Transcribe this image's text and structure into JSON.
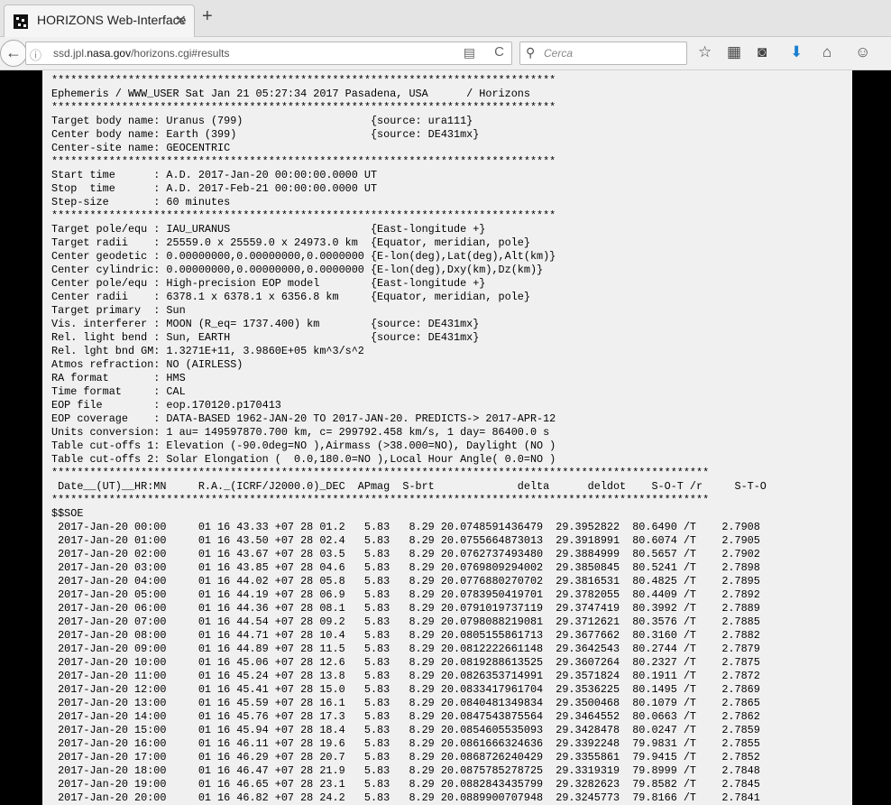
{
  "tab": {
    "title": "HORIZONS Web-Interface",
    "close": "✕",
    "new": "+"
  },
  "nav": {
    "back": "←",
    "url_prefix": "ssd.jpl.",
    "url_domain": "nasa.gov",
    "url_suffix": "/horizons.cgi#results",
    "reader": "▤",
    "reload": "C",
    "search_placeholder": "Cerca",
    "toolbar": [
      "☆",
      "▦",
      "◙",
      "⬇",
      "⌂",
      "☺"
    ]
  },
  "lines": [
    "*******************************************************************************",
    "Ephemeris / WWW_USER Sat Jan 21 05:27:34 2017 Pasadena, USA      / Horizons",
    "*******************************************************************************",
    "Target body name: Uranus (799)                    {source: ura111}",
    "Center body name: Earth (399)                     {source: DE431mx}",
    "Center-site name: GEOCENTRIC",
    "*******************************************************************************",
    "Start time      : A.D. 2017-Jan-20 00:00:00.0000 UT",
    "Stop  time      : A.D. 2017-Feb-21 00:00:00.0000 UT",
    "Step-size       : 60 minutes",
    "*******************************************************************************",
    "Target pole/equ : IAU_URANUS                      {East-longitude +}",
    "Target radii    : 25559.0 x 25559.0 x 24973.0 km  {Equator, meridian, pole}",
    "Center geodetic : 0.00000000,0.00000000,0.0000000 {E-lon(deg),Lat(deg),Alt(km)}",
    "Center cylindric: 0.00000000,0.00000000,0.0000000 {E-lon(deg),Dxy(km),Dz(km)}",
    "Center pole/equ : High-precision EOP model        {East-longitude +}",
    "Center radii    : 6378.1 x 6378.1 x 6356.8 km     {Equator, meridian, pole}",
    "Target primary  : Sun",
    "Vis. interferer : MOON (R_eq= 1737.400) km        {source: DE431mx}",
    "Rel. light bend : Sun, EARTH                      {source: DE431mx}",
    "Rel. lght bnd GM: 1.3271E+11, 3.9860E+05 km^3/s^2",
    "Atmos refraction: NO (AIRLESS)",
    "RA format       : HMS",
    "Time format     : CAL",
    "EOP file        : eop.170120.p170413",
    "EOP coverage    : DATA-BASED 1962-JAN-20 TO 2017-JAN-20. PREDICTS-> 2017-APR-12",
    "Units conversion: 1 au= 149597870.700 km, c= 299792.458 km/s, 1 day= 86400.0 s",
    "Table cut-offs 1: Elevation (-90.0deg=NO ),Airmass (>38.000=NO), Daylight (NO )",
    "Table cut-offs 2: Solar Elongation (  0.0,180.0=NO ),Local Hour Angle( 0.0=NO )",
    "*******************************************************************************************************",
    " Date__(UT)__HR:MN     R.A._(ICRF/J2000.0)_DEC  APmag  S-brt             delta      deldot    S-O-T /r     S-T-O",
    "*******************************************************************************************************",
    "$$SOE",
    " 2017-Jan-20 00:00     01 16 43.33 +07 28 01.2   5.83   8.29 20.0748591436479  29.3952822  80.6490 /T    2.7908",
    " 2017-Jan-20 01:00     01 16 43.50 +07 28 02.4   5.83   8.29 20.0755664873013  29.3918991  80.6074 /T    2.7905",
    " 2017-Jan-20 02:00     01 16 43.67 +07 28 03.5   5.83   8.29 20.0762737493480  29.3884999  80.5657 /T    2.7902",
    " 2017-Jan-20 03:00     01 16 43.85 +07 28 04.6   5.83   8.29 20.0769809294002  29.3850845  80.5241 /T    2.7898",
    " 2017-Jan-20 04:00     01 16 44.02 +07 28 05.8   5.83   8.29 20.0776880270702  29.3816531  80.4825 /T    2.7895",
    " 2017-Jan-20 05:00     01 16 44.19 +07 28 06.9   5.83   8.29 20.0783950419701  29.3782055  80.4409 /T    2.7892",
    " 2017-Jan-20 06:00     01 16 44.36 +07 28 08.1   5.83   8.29 20.0791019737119  29.3747419  80.3992 /T    2.7889",
    " 2017-Jan-20 07:00     01 16 44.54 +07 28 09.2   5.83   8.29 20.0798088219081  29.3712621  80.3576 /T    2.7885",
    " 2017-Jan-20 08:00     01 16 44.71 +07 28 10.4   5.83   8.29 20.0805155861713  29.3677662  80.3160 /T    2.7882",
    " 2017-Jan-20 09:00     01 16 44.89 +07 28 11.5   5.83   8.29 20.0812222661148  29.3642543  80.2744 /T    2.7879",
    " 2017-Jan-20 10:00     01 16 45.06 +07 28 12.6   5.83   8.29 20.0819288613525  29.3607264  80.2327 /T    2.7875",
    " 2017-Jan-20 11:00     01 16 45.24 +07 28 13.8   5.83   8.29 20.0826353714991  29.3571824  80.1911 /T    2.7872",
    " 2017-Jan-20 12:00     01 16 45.41 +07 28 15.0   5.83   8.29 20.0833417961704  29.3536225  80.1495 /T    2.7869",
    " 2017-Jan-20 13:00     01 16 45.59 +07 28 16.1   5.83   8.29 20.0840481349834  29.3500468  80.1079 /T    2.7865",
    " 2017-Jan-20 14:00     01 16 45.76 +07 28 17.3   5.83   8.29 20.0847543875564  29.3464552  80.0663 /T    2.7862",
    " 2017-Jan-20 15:00     01 16 45.94 +07 28 18.4   5.83   8.29 20.0854605535093  29.3428478  80.0247 /T    2.7859",
    " 2017-Jan-20 16:00     01 16 46.11 +07 28 19.6   5.83   8.29 20.0861666324636  29.3392248  79.9831 /T    2.7855",
    " 2017-Jan-20 17:00     01 16 46.29 +07 28 20.7   5.83   8.29 20.0868726240429  29.3355861  79.9415 /T    2.7852",
    " 2017-Jan-20 18:00     01 16 46.47 +07 28 21.9   5.83   8.29 20.0875785278725  29.3319319  79.8999 /T    2.7848",
    " 2017-Jan-20 19:00     01 16 46.65 +07 28 23.1   5.83   8.29 20.0882843435799  29.3282623  79.8582 /T    2.7845",
    " 2017-Jan-20 20:00     01 16 46.82 +07 28 24.2   5.83   8.29 20.0889900707948  29.3245773  79.8166 /T    2.7841"
  ]
}
